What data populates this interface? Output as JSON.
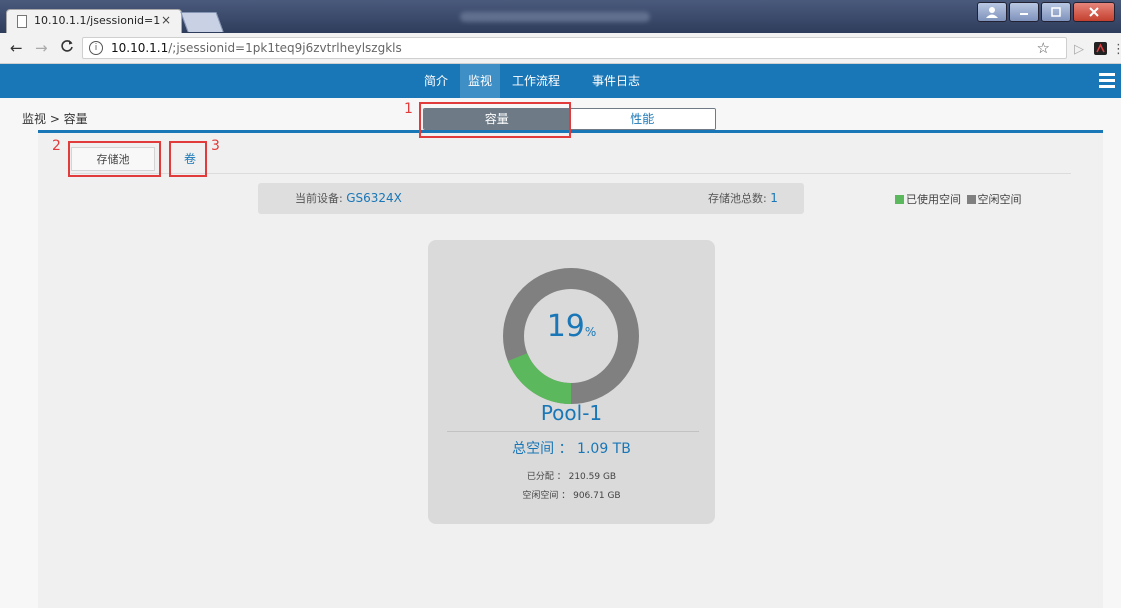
{
  "browser": {
    "tab_title": "10.10.1.1/jsessionid=1",
    "tab_close": "×",
    "url_host": "10.10.1.1",
    "url_path": "/;jsessionid=1pk1teq9j6zvtrlheylszgkls"
  },
  "appnav": {
    "items": [
      "简介",
      "监视",
      "工作流程",
      "事件日志"
    ],
    "active_index": 1
  },
  "breadcrumb": "监视 > 容量",
  "segmented": {
    "left": "容量",
    "right": "性能",
    "active": "容量"
  },
  "subtabs": {
    "pool": "存储池",
    "volume": "卷"
  },
  "infobar": {
    "device_label": "当前设备:",
    "device_value": "GS6324X",
    "pool_count_label": "存储池总数:",
    "pool_count_value": "1"
  },
  "legend": {
    "used": "已使用空间",
    "free": "空闲空间",
    "used_color": "#5cb85c",
    "free_color": "#808080"
  },
  "pool": {
    "percent": "19",
    "percent_sign": "%",
    "used_fraction": 0.19,
    "name": "Pool-1",
    "total_label": "总空间 ： 1.09 TB",
    "allocated": "已分配 ： 210.59 GB",
    "free": "空闲空间 ： 906.71 GB"
  },
  "annotations": [
    "1",
    "2",
    "3"
  ],
  "colors": {
    "nav_blue": "#1a77b7",
    "accent_text": "#1a77b7",
    "annotation_red": "#e23b3b"
  }
}
